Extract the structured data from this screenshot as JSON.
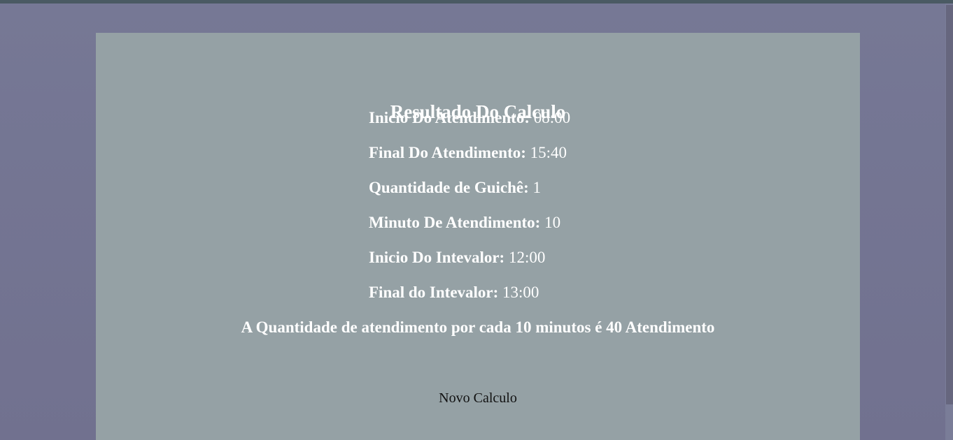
{
  "result": {
    "title": "Resultado Do Calculo",
    "details": [
      {
        "label": "Inicio Do Atendimento:",
        "value": "08:00"
      },
      {
        "label": "Final Do Atendimento:",
        "value": "15:40"
      },
      {
        "label": "Quantidade de Guichê:",
        "value": "1"
      },
      {
        "label": "Minuto De Atendimento:",
        "value": "10"
      },
      {
        "label": "Inicio Do Intevalor:",
        "value": "12:00"
      },
      {
        "label": "Final do Intevalor:",
        "value": "13:00"
      }
    ],
    "summary": "A Quantidade de atendimento por cada 10 minutos é 40 Atendimento"
  },
  "actions": {
    "new_calc_label": "Novo Calculo"
  }
}
